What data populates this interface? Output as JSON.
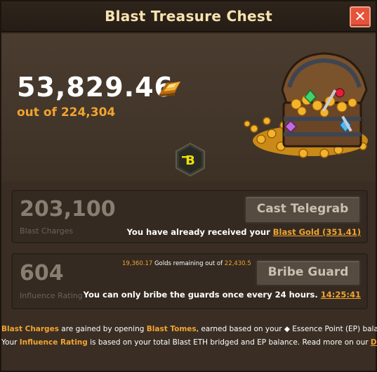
{
  "window": {
    "title": "Blast Treasure Chest",
    "close_label": "✕"
  },
  "hero": {
    "amount": "53,829.46",
    "out_of": "out of 224,304"
  },
  "charges_panel": {
    "value": "203,100",
    "label": "Blast Charges",
    "button_label": "Cast Telegrab",
    "note_prefix": "You have already received your ",
    "note_link": "Blast Gold (351.41)"
  },
  "influence_panel": {
    "value": "604",
    "label": "Influence Rating",
    "remaining_value": "19,360.17",
    "remaining_text": " Golds remaining out of ",
    "remaining_total": "22,430.5",
    "button_label": "Bribe Guard",
    "note_prefix": "You can only bribe the guards once every 24 hours. ",
    "timer": "14:25:41"
  },
  "footer": {
    "line1_hl1": "Blast Charges",
    "line1_t1": " are gained by opening ",
    "line1_hl2": "Blast Tomes",
    "line1_t2": ", earned based on your ◆ Essence Point (EP) balance.",
    "line2_t1": "Your ",
    "line2_hl1": "Influence Rating",
    "line2_t2": " is based on your total Blast ETH bridged and EP balance. Read more on our ",
    "line2_link": "Docs",
    "line2_t3": "."
  },
  "colors": {
    "accent_orange": "#f1a430",
    "close_red": "#e5533b",
    "title_cream": "#f7e3b0"
  },
  "icons": {
    "gold": "gold-bar-icon",
    "chest": "treasure-chest-icon",
    "logo": "blast-logo-icon",
    "close": "close-icon"
  }
}
